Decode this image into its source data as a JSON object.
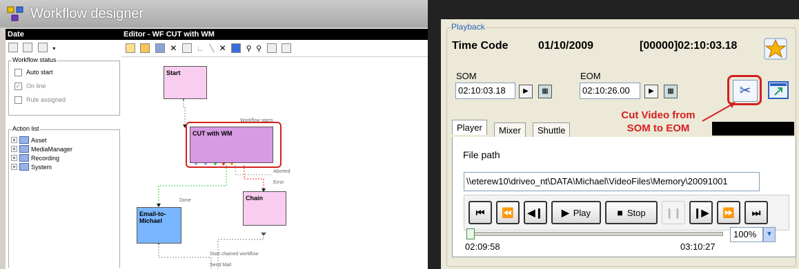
{
  "workflow": {
    "title": "Workflow designer",
    "left_header": "Date",
    "status_group": "Workflow status",
    "status_items": [
      {
        "label": "Auto start",
        "checked": false,
        "enabled": true
      },
      {
        "label": "On line",
        "checked": true,
        "enabled": false
      },
      {
        "label": "Rule assigned",
        "checked": false,
        "enabled": false
      }
    ],
    "action_group": "Action list",
    "action_items": [
      "Asset",
      "MediaManager",
      "Recording",
      "System"
    ],
    "editor_header": "Editor - WF CUT with WM",
    "nodes": {
      "start": "Start",
      "cut": "CUT with WM",
      "email": "Email-to-\nMichael",
      "chain": "Chain"
    },
    "connections": {
      "workflow_starts": "Workflow starts",
      "aborted": "Aborted",
      "error": "Error",
      "done": "Done",
      "start_chained": "Start chained workflow",
      "send_mail": "Send Mail"
    }
  },
  "playback": {
    "legend": "Playback",
    "time_code_label": "Time Code",
    "date": "01/10/2009",
    "time_code": "[00000]02:10:03.18",
    "som_label": "SOM",
    "som_value": "02:10:03.18",
    "eom_label": "EOM",
    "eom_value": "02:10:26.00",
    "annotation_line1": "Cut Video from",
    "annotation_line2": "SOM to EOM",
    "tabs": [
      "Player",
      "Mixer",
      "Shuttle"
    ],
    "file_path_label": "File path",
    "file_path_value": "\\\\eterew10\\driveo_nt\\DATA\\Michael\\VideoFiles\\Memory\\20091001",
    "play_label": "Play",
    "stop_label": "Stop",
    "slider_start": "02:09:58",
    "slider_end": "03:10:27",
    "slider_position": 0.0,
    "zoom_value": "100%",
    "annotation_color": "#d42020",
    "accent_color": "#3262b5"
  }
}
